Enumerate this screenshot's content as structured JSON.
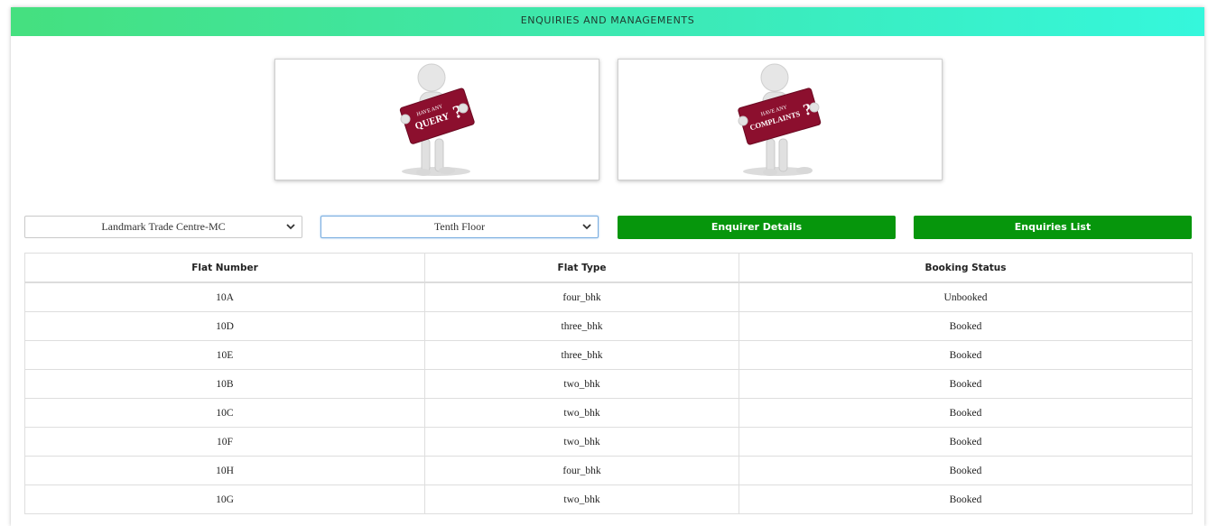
{
  "header": {
    "title": "ENQUIRIES AND MANAGEMENTS"
  },
  "cards": {
    "query": {
      "line1": "HAVE ANY",
      "line2": "QUERY",
      "mark": "?"
    },
    "complaints": {
      "line1": "HAVE ANY",
      "line2": "COMPLAINTS",
      "mark": "?"
    }
  },
  "filters": {
    "building": {
      "selected": "Landmark Trade Centre-MC",
      "icon": "chevron-down-icon"
    },
    "floor": {
      "selected": "Tenth Floor",
      "icon": "chevron-down-icon"
    }
  },
  "buttons": {
    "enquirer_details": "Enquirer Details",
    "enquiries_list": "Enquiries List"
  },
  "table": {
    "headers": [
      "Flat Number",
      "Flat Type",
      "Booking Status"
    ],
    "rows": [
      [
        "10A",
        "four_bhk",
        "Unbooked"
      ],
      [
        "10D",
        "three_bhk",
        "Booked"
      ],
      [
        "10E",
        "three_bhk",
        "Booked"
      ],
      [
        "10B",
        "two_bhk",
        "Booked"
      ],
      [
        "10C",
        "two_bhk",
        "Booked"
      ],
      [
        "10F",
        "two_bhk",
        "Booked"
      ],
      [
        "10H",
        "four_bhk",
        "Booked"
      ],
      [
        "10G",
        "two_bhk",
        "Booked"
      ]
    ]
  },
  "colors": {
    "header_gradient_start": "#45e07f",
    "header_gradient_end": "#35f7dc",
    "button_green": "#06960c",
    "sign_red": "#8c0f2e"
  }
}
